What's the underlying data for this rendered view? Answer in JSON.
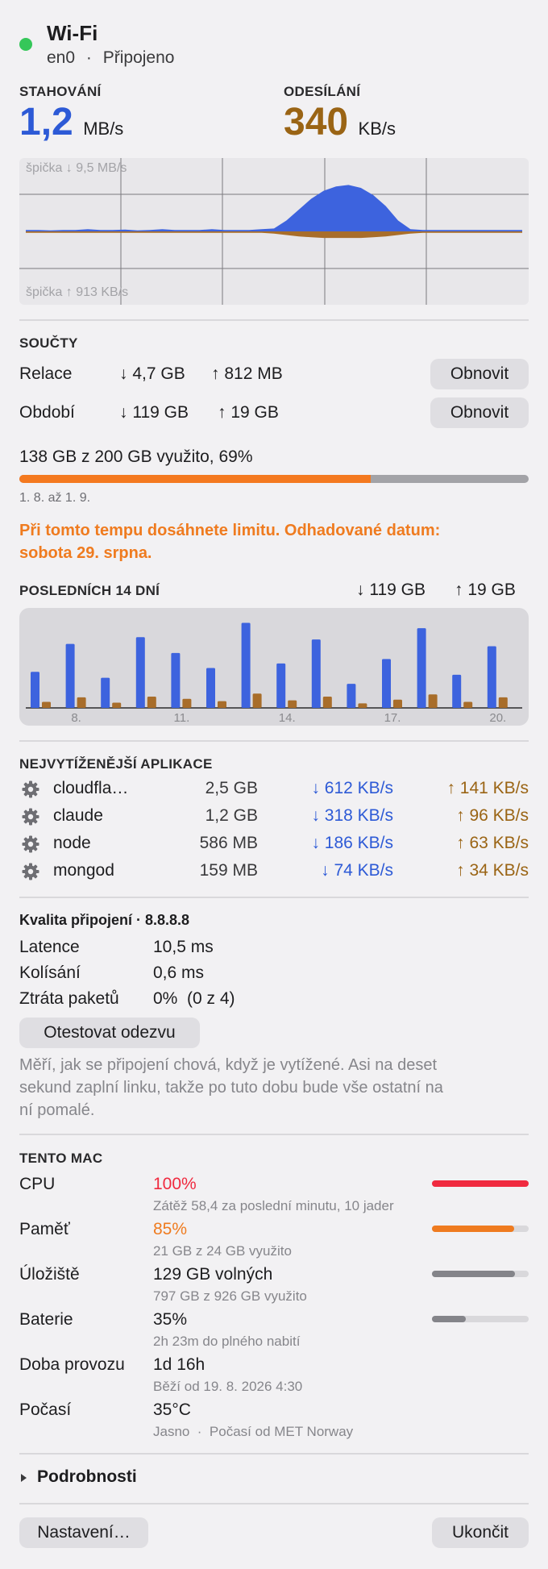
{
  "header": {
    "title": "Wi-Fi",
    "interface": "en0",
    "separator": "·",
    "status": "Připojeno",
    "status_color": "#35c759"
  },
  "rates": {
    "download": {
      "label": "STAHOVÁNÍ",
      "value": "1,2",
      "unit": "MB/s",
      "color": "#2d5ad6"
    },
    "upload": {
      "label": "ODESÍLÁNÍ",
      "value": "340",
      "unit": "KB/s",
      "color": "#9a6414"
    }
  },
  "graph": {
    "peak_down": "špička ↓ 9,5 MB/s",
    "peak_up": "špička ↑ 913 KB/s",
    "download_profile": [
      0.02,
      0.02,
      0.015,
      0.02,
      0.02,
      0.03,
      0.02,
      0.02,
      0.025,
      0.015,
      0.02,
      0.03,
      0.02,
      0.02,
      0.02,
      0.03,
      0.02,
      0.02,
      0.02,
      0.03,
      0.04,
      0.15,
      0.3,
      0.45,
      0.56,
      0.62,
      0.64,
      0.6,
      0.5,
      0.35,
      0.15,
      0.03,
      0.02,
      0.02,
      0.02,
      0.02,
      0.02,
      0.02,
      0.02,
      0.02,
      0.02
    ],
    "upload_profile": [
      0.02,
      0.02,
      0.02,
      0.02,
      0.02,
      0.02,
      0.02,
      0.02,
      0.02,
      0.02,
      0.02,
      0.02,
      0.02,
      0.02,
      0.02,
      0.02,
      0.02,
      0.02,
      0.02,
      0.02,
      0.03,
      0.05,
      0.07,
      0.08,
      0.09,
      0.09,
      0.09,
      0.09,
      0.08,
      0.07,
      0.05,
      0.03,
      0.02,
      0.02,
      0.02,
      0.02,
      0.02,
      0.02,
      0.02,
      0.02,
      0.02
    ]
  },
  "totals": {
    "section": "SOUČTY",
    "session": {
      "label": "Relace",
      "down": "↓ 4,7 GB",
      "up": "↑ 812 MB",
      "reset": "Obnovit"
    },
    "period": {
      "label": "Období",
      "down": "↓ 119 GB",
      "up": "↑ 19 GB",
      "reset": "Obnovit"
    },
    "usage_text": "138 GB z 200 GB využito, 69%",
    "usage_fraction": 0.69,
    "range": "1. 8. až 1. 9.",
    "warning_line1": "Při tomto tempu dosáhnete limitu. Odhadované datum:",
    "warning_line2": "sobota 29. srpna."
  },
  "last14": {
    "section": "POSLEDNÍCH 14 DNÍ",
    "down": "↓ 119 GB",
    "up": "↑ 19 GB"
  },
  "chart_data": {
    "type": "bar",
    "categories": [
      "7.",
      "8.",
      "9.",
      "10.",
      "11.",
      "12.",
      "13.",
      "14.",
      "15.",
      "16.",
      "17.",
      "18.",
      "19.",
      "20."
    ],
    "tick_labels": [
      "8.",
      "11.",
      "14.",
      "17.",
      "20."
    ],
    "series": [
      {
        "name": "↓",
        "color": "#3d63de",
        "values": [
          4.8,
          8.5,
          4.0,
          9.4,
          7.3,
          5.3,
          11.3,
          5.9,
          9.1,
          3.2,
          6.5,
          10.6,
          4.4,
          8.2
        ]
      },
      {
        "name": "↑",
        "color": "#a86d2a",
        "values": [
          0.8,
          1.4,
          0.7,
          1.5,
          1.2,
          0.9,
          1.9,
          1.0,
          1.5,
          0.6,
          1.1,
          1.8,
          0.8,
          1.4
        ]
      }
    ],
    "ylim": [
      0,
      12
    ]
  },
  "apps": {
    "section": "NEJVYTÍŽENĚJŠÍ APLIKACE",
    "items": [
      {
        "name": "cloudfla…",
        "total": "2,5 GB",
        "down": "↓ 612 KB/s",
        "up": "↑ 141 KB/s"
      },
      {
        "name": "claude",
        "total": "1,2 GB",
        "down": "↓ 318 KB/s",
        "up": "↑ 96 KB/s"
      },
      {
        "name": "node",
        "total": "586 MB",
        "down": "↓ 186 KB/s",
        "up": "↑ 63 KB/s"
      },
      {
        "name": "mongod",
        "total": "159 MB",
        "down": "↓ 74 KB/s",
        "up": "↑ 34 KB/s"
      }
    ]
  },
  "quality": {
    "title": "Kvalita připojení · 8.8.8.8",
    "rows": [
      {
        "label": "Latence",
        "value": "10,5 ms"
      },
      {
        "label": "Kolísání",
        "value": "0,6 ms"
      },
      {
        "label": "Ztráta paketů",
        "value": "0%  (0 z 4)"
      }
    ],
    "test_button": "Otestovat odezvu",
    "desc_line1": "Měří, jak se připojení chová, když je vytížené. Asi na deset",
    "desc_line2": "sekund zaplní linku, takže po tuto dobu bude vše ostatní na",
    "desc_line3": "ní pomalé."
  },
  "mac": {
    "section": "TENTO MAC",
    "cpu": {
      "label": "CPU",
      "value": "100%",
      "sub": "Zátěž 58,4 za poslední minutu, 10 jader",
      "fraction": 1.0,
      "color": "#f02a3f"
    },
    "memory": {
      "label": "Paměť",
      "value": "85%",
      "sub": "21 GB z 24 GB využito",
      "fraction": 0.85,
      "color": "#ef7b1f"
    },
    "storage": {
      "label": "Úložiště",
      "value": "129 GB volných",
      "sub": "797 GB z 926 GB využito",
      "fraction": 0.86,
      "color": "#848489"
    },
    "battery": {
      "label": "Baterie",
      "value": "35%",
      "sub": "2h 23m do plného nabití",
      "fraction": 0.35,
      "color": "#848489"
    },
    "uptime": {
      "label": "Doba provozu",
      "value": "1d 16h",
      "sub": "Běží od 19. 8. 2026 4:30"
    },
    "weather": {
      "label": "Počasí",
      "value": "35°C",
      "sub": "Jasno  ·  Počasí od MET Norway"
    }
  },
  "details": {
    "label": "Podrobnosti",
    "icon": "disclosure-triangle-icon"
  },
  "footer": {
    "settings": "Nastavení…",
    "quit": "Ukončit"
  }
}
